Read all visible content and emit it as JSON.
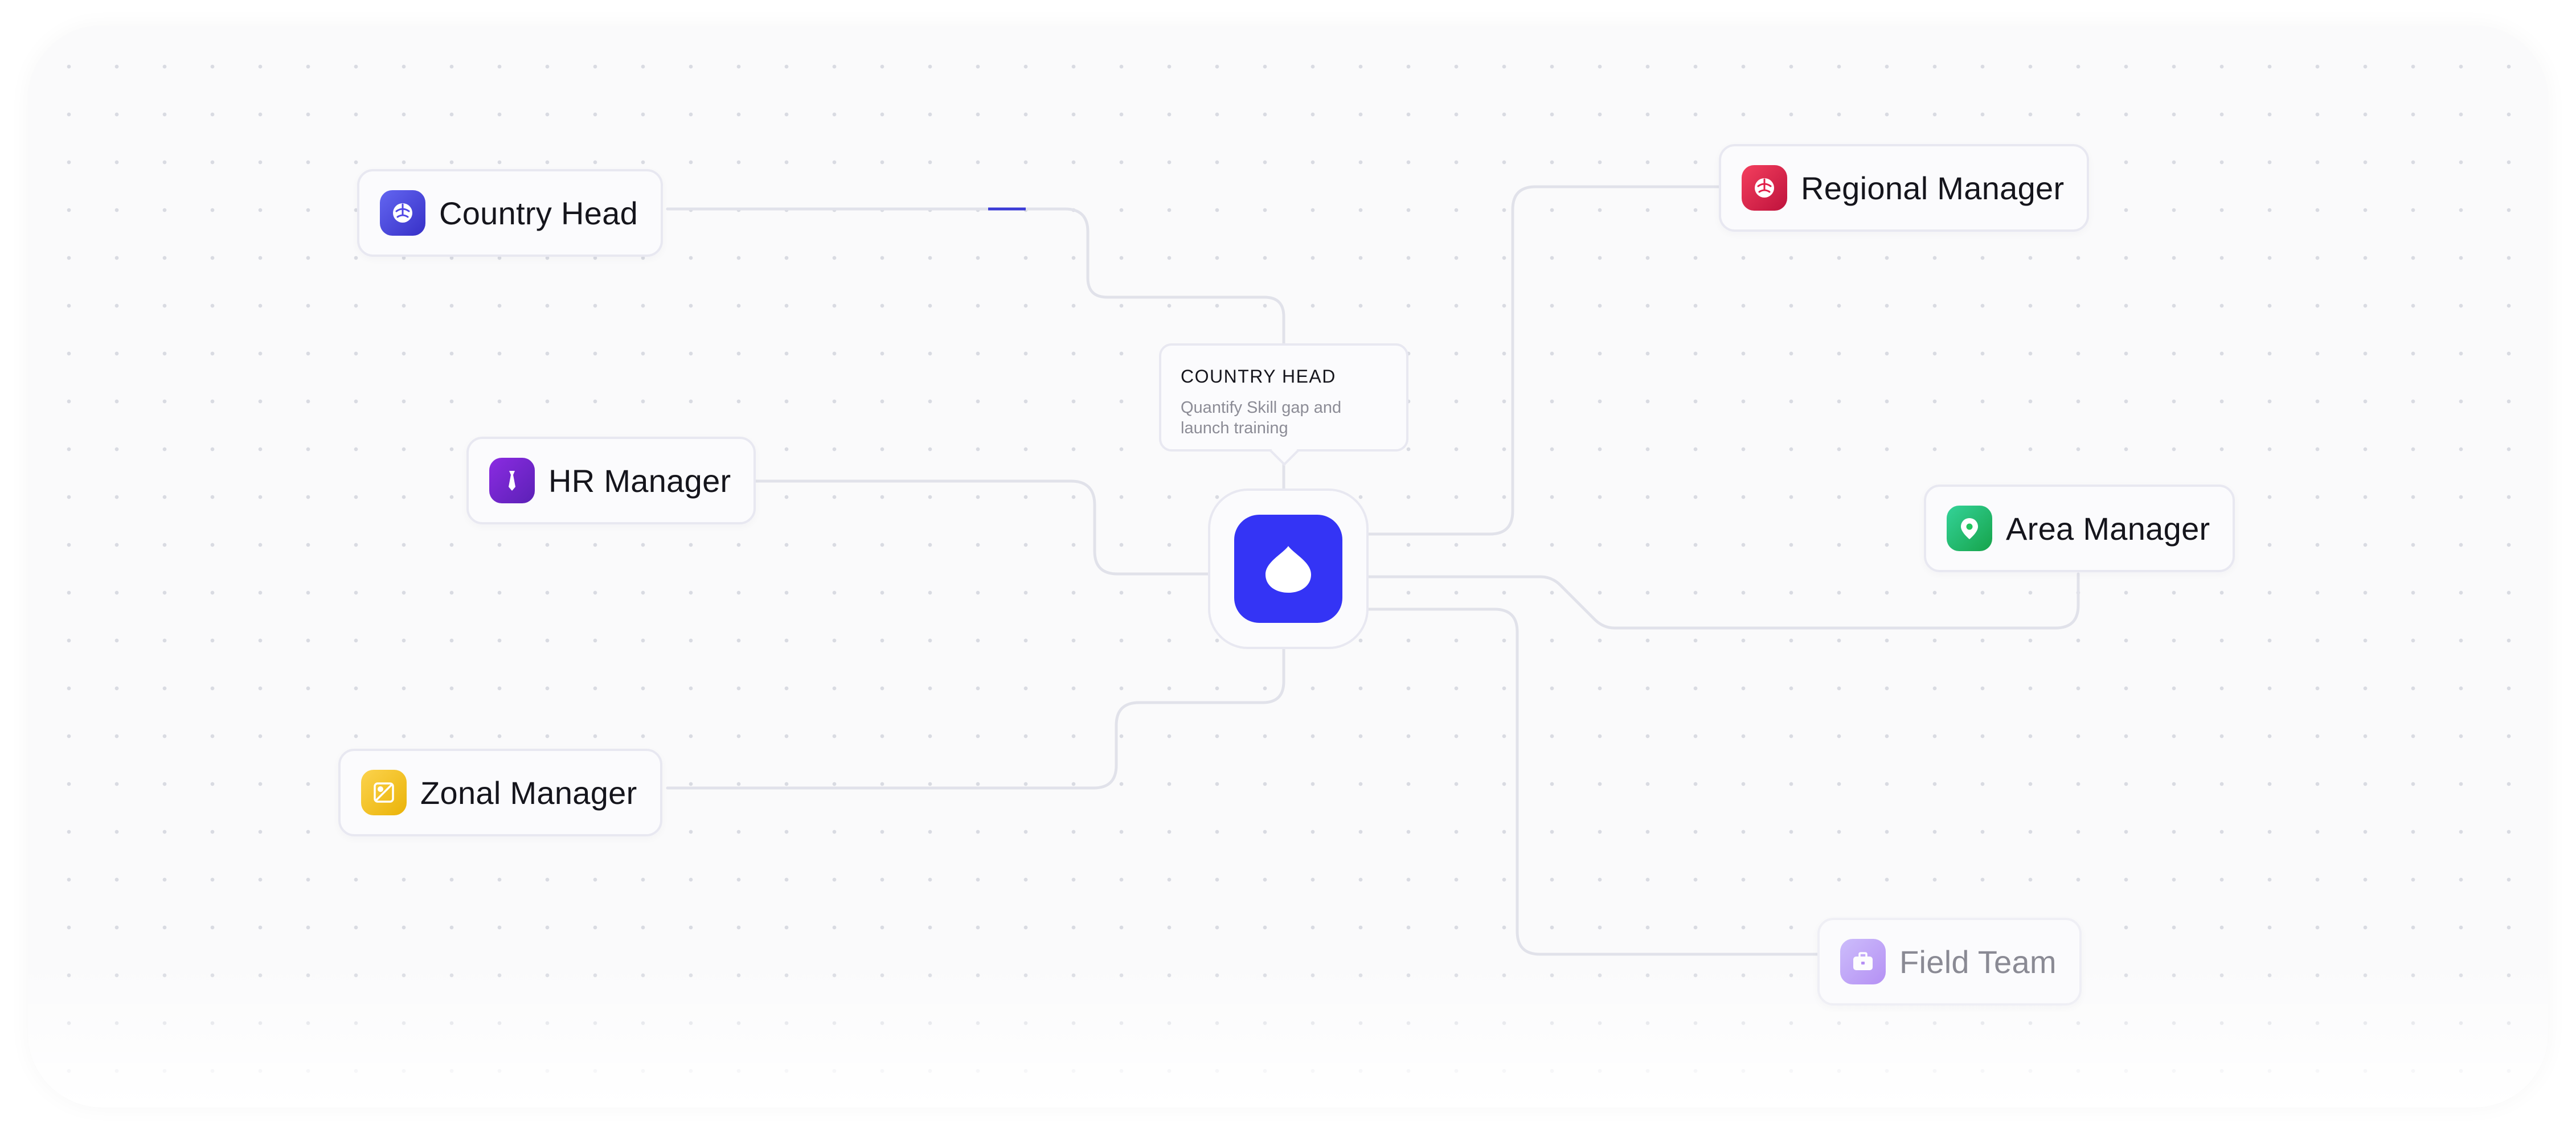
{
  "diagram": {
    "tooltip": {
      "title": "COUNTRY HEAD",
      "description": "Quantify Skill gap and launch training"
    },
    "nodes": [
      {
        "id": "country-head",
        "label": "Country Head",
        "icon": "brain-icon",
        "color": "#4f46e5"
      },
      {
        "id": "hr-manager",
        "label": "HR Manager",
        "icon": "tie-icon",
        "color": "#6d28d9"
      },
      {
        "id": "zonal-manager",
        "label": "Zonal Manager",
        "icon": "map-icon",
        "color": "#f5c518"
      },
      {
        "id": "regional-manager",
        "label": "Regional Manager",
        "icon": "brain-icon",
        "color": "#e11d48"
      },
      {
        "id": "area-manager",
        "label": "Area Manager",
        "icon": "location-pin-icon",
        "color": "#22c55e"
      },
      {
        "id": "field-team",
        "label": "Field Team",
        "icon": "briefcase-icon",
        "color": "#7c3aed"
      }
    ],
    "hub": {
      "icon": "droplet-icon",
      "color": "#3434f5"
    },
    "edge_color": "#e1e2ea",
    "highlight_color": "#3b3bd6"
  }
}
